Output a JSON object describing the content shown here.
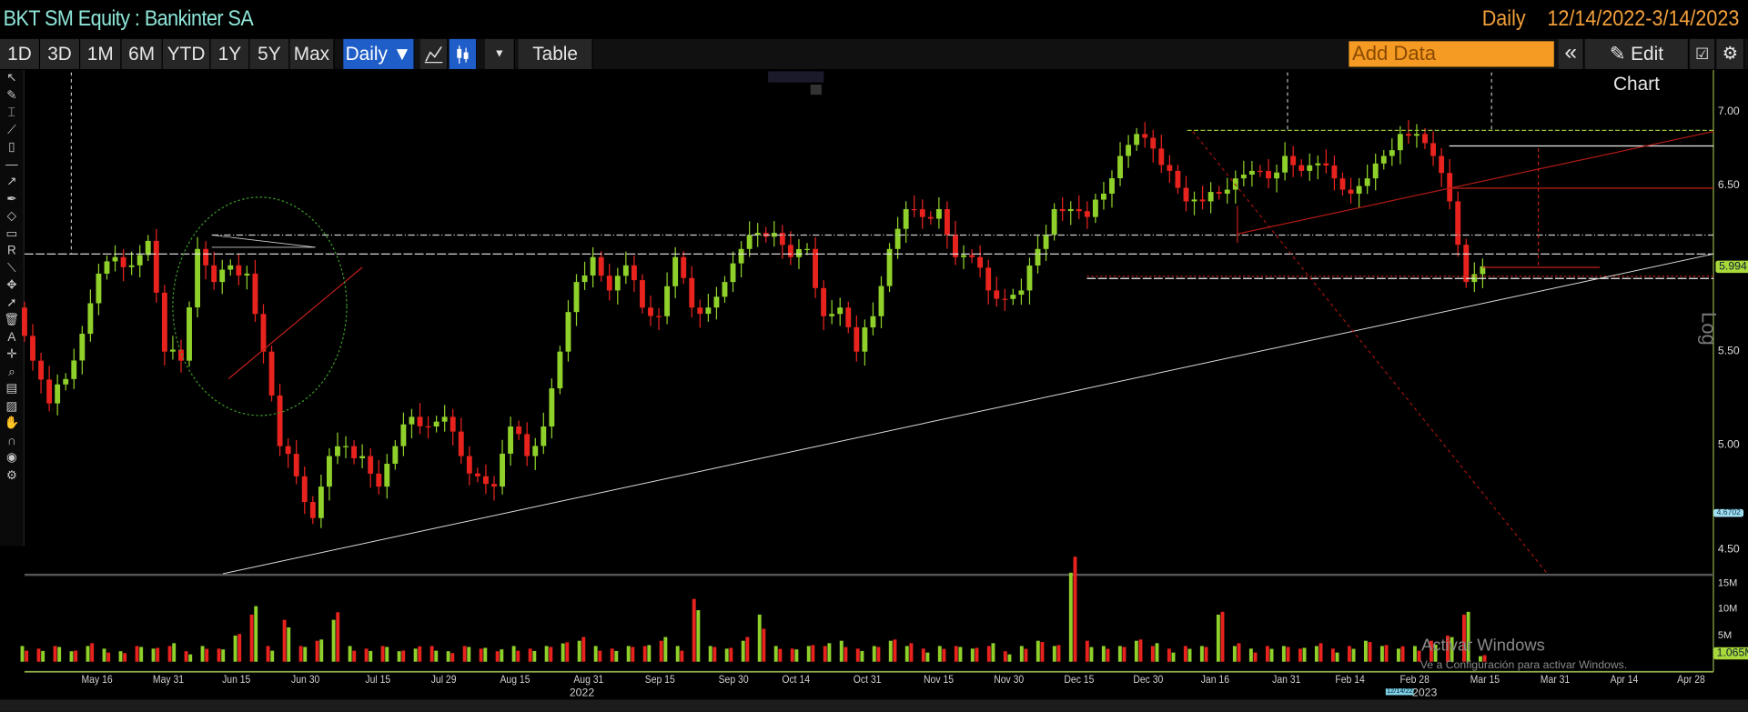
{
  "header": {
    "title": "BKT SM Equity : Bankinter SA",
    "frequency": "Daily",
    "date_range": "12/14/2022-3/14/2023"
  },
  "toolbar": {
    "periods": [
      "1D",
      "3D",
      "1M",
      "6M",
      "YTD",
      "1Y",
      "5Y",
      "Max"
    ],
    "frequency_dropdown": "Daily ▼",
    "table_label": "Table",
    "add_data_placeholder": "Add Data",
    "collapse_label": "«",
    "edit_chart_label": "Edit Chart"
  },
  "left_tools": [
    "arrow-icon",
    "pencil-icon",
    "cursor-text-icon",
    "brush-icon",
    "ruler-icon",
    "line-icon",
    "ray-icon",
    "pen-icon",
    "shape-icon",
    "ribbon-icon",
    "text-r-icon",
    "line-diag-icon",
    "move-icon",
    "pointer-icon",
    "delete-icon",
    "annotate-icon",
    "crosshair-icon",
    "zoom-icon",
    "layers-icon",
    "highlight-icon",
    "hand-icon",
    "magnet-icon",
    "palette-icon",
    "settings-icon"
  ],
  "price_axis": {
    "scale": "Log",
    "scale_label": "Log",
    "ticks": [
      "7.00",
      "6.50",
      "5.50",
      "5.00",
      "4.50"
    ],
    "last_price": "5.994",
    "low_marker": "4.6702"
  },
  "volume_axis": {
    "ticks": [
      "15M",
      "10M",
      "5M"
    ],
    "last_volume": "1.065M"
  },
  "x_axis": {
    "ticks": [
      "May 16",
      "May 31",
      "Jun 15",
      "Jun 30",
      "Jul 15",
      "Jul 29",
      "Aug 15",
      "Aug 31",
      "Sep 15",
      "Sep 30",
      "Oct 14",
      "Oct 31",
      "Nov 15",
      "Nov 30",
      "Dec 15",
      "Dec 30",
      "Jan 16",
      "Jan 31",
      "Feb 14",
      "Feb 28",
      "Mar 15",
      "Mar 31",
      "Apr 14",
      "Apr 28"
    ],
    "years": [
      "2022",
      "2023"
    ],
    "cursor_date": "12/14/22"
  },
  "watermark": {
    "line1": "Activar Windows",
    "line2": "Ve a Configuración para activar Windows."
  },
  "colors": {
    "up": "#8fd12a",
    "down": "#e8231e",
    "accent_orange": "#f59a23",
    "title_cyan": "#8ee6d8",
    "active_blue": "#1f5ec8"
  },
  "chart_data": {
    "type": "candlestick",
    "y_scale": "log",
    "ylim": [
      4.45,
      7.1
    ],
    "x_range": [
      "May 2022",
      "Apr 28 2023"
    ],
    "closes": [
      5.75,
      5.45,
      5.22,
      5.35,
      5.6,
      5.95,
      6.05,
      6.0,
      6.15,
      5.5,
      5.45,
      6.1,
      5.9,
      6.0,
      5.95,
      5.5,
      5.0,
      4.85,
      4.65,
      4.95,
      5.0,
      4.95,
      4.8,
      5.0,
      5.15,
      5.1,
      5.15,
      4.95,
      4.85,
      4.8,
      5.1,
      4.95,
      5.1,
      5.5,
      5.9,
      6.05,
      5.85,
      6.0,
      5.75,
      5.7,
      6.05,
      5.75,
      5.75,
      5.9,
      6.1,
      6.2,
      6.2,
      6.05,
      6.1,
      5.7,
      5.75,
      5.5,
      5.7,
      6.1,
      6.35,
      6.3,
      6.35,
      6.05,
      6.05,
      5.85,
      5.8,
      5.85,
      6.1,
      6.35,
      6.35,
      6.3,
      6.45,
      6.7,
      6.85,
      6.75,
      6.6,
      6.4,
      6.4,
      6.45,
      6.55,
      6.6,
      6.55,
      6.7,
      6.6,
      6.65,
      6.55,
      6.45,
      6.55,
      6.7,
      6.85,
      6.85,
      6.7,
      6.4,
      5.9,
      5.994
    ],
    "volume_millions": [
      3,
      2.5,
      3,
      2,
      3,
      2.5,
      2,
      3,
      2.5,
      3,
      2,
      3,
      2.5,
      5,
      9,
      3,
      8,
      3,
      4,
      8,
      3,
      2.5,
      3,
      2,
      2.5,
      3,
      2,
      3,
      2.5,
      2,
      3,
      2.5,
      3,
      3.5,
      4,
      3,
      2.5,
      3,
      3,
      4,
      3,
      12,
      3,
      2.5,
      4,
      9,
      3,
      2.5,
      3,
      3,
      4,
      2.5,
      3,
      4,
      3,
      2.5,
      3,
      3,
      2.5,
      3,
      2,
      3,
      4,
      3,
      17,
      4,
      3,
      3,
      4,
      3,
      2.5,
      3,
      3,
      9,
      3,
      2.5,
      3,
      3,
      2.5,
      3,
      2.5,
      3,
      4,
      3,
      2.5,
      3,
      4,
      5,
      9,
      1.065
    ]
  }
}
